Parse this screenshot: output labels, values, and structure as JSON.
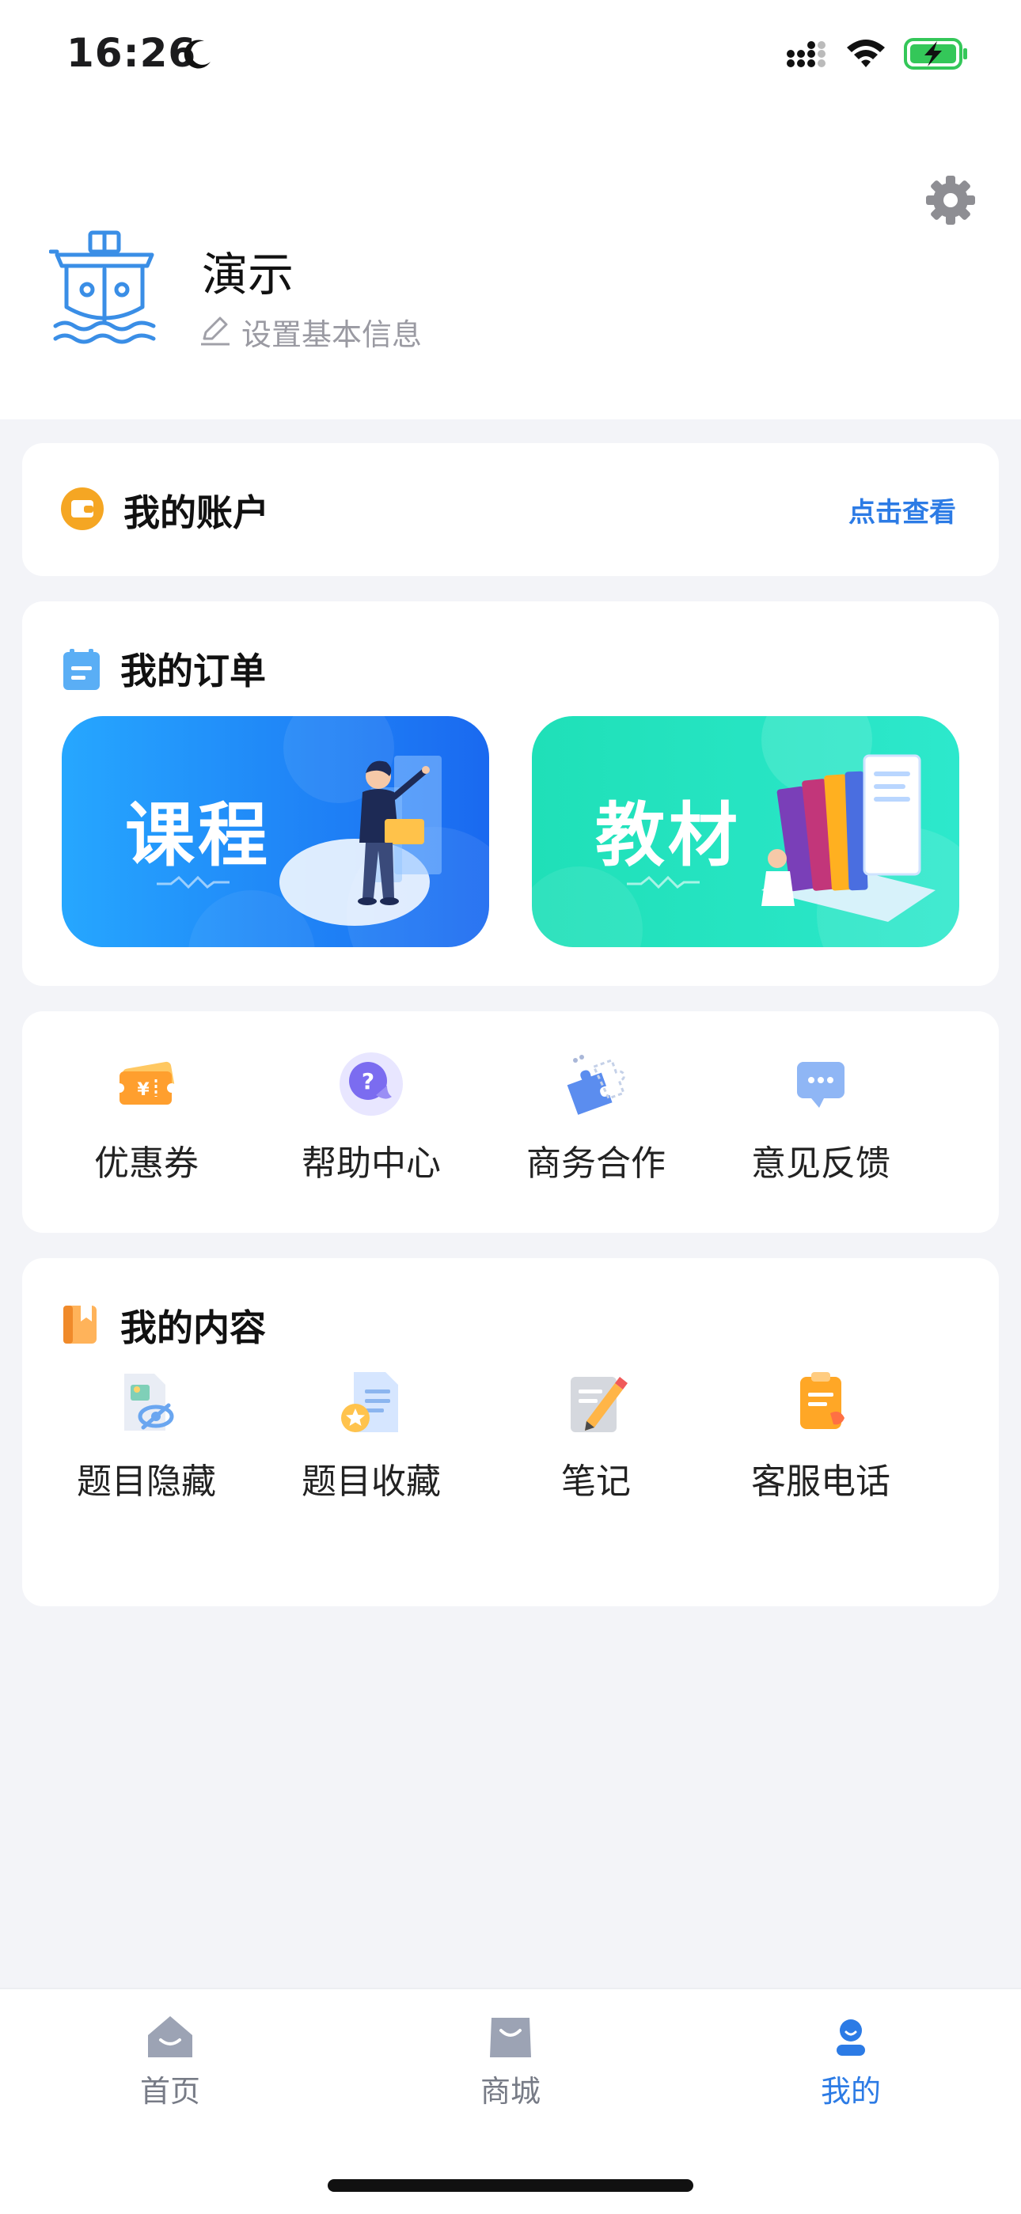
{
  "status": {
    "time": "16:26"
  },
  "profile": {
    "name": "演示",
    "edit_label": "设置基本信息"
  },
  "account": {
    "title": "我的账户",
    "view_label": "点击查看"
  },
  "orders": {
    "title": "我的订单",
    "banners": [
      {
        "label": "课程"
      },
      {
        "label": "教材"
      }
    ]
  },
  "tools": {
    "items": [
      {
        "label": "优惠券",
        "icon": "coupon-icon"
      },
      {
        "label": "帮助中心",
        "icon": "help-icon"
      },
      {
        "label": "商务合作",
        "icon": "puzzle-icon"
      },
      {
        "label": "意见反馈",
        "icon": "feedback-icon"
      }
    ]
  },
  "content": {
    "title": "我的内容",
    "items": [
      {
        "label": "题目隐藏",
        "icon": "hidden-question-icon"
      },
      {
        "label": "题目收藏",
        "icon": "favorite-question-icon"
      },
      {
        "label": "笔记",
        "icon": "note-icon"
      },
      {
        "label": "客服电话",
        "icon": "service-phone-icon"
      }
    ]
  },
  "tabbar": {
    "tabs": [
      {
        "label": "首页",
        "icon": "home-icon"
      },
      {
        "label": "商城",
        "icon": "shop-icon"
      },
      {
        "label": "我的",
        "icon": "profile-icon",
        "active": true
      }
    ]
  },
  "colors": {
    "accent": "#2c7be5",
    "background": "#f3f4f8",
    "wallet": "#f5a623",
    "battery": "#34c759"
  }
}
